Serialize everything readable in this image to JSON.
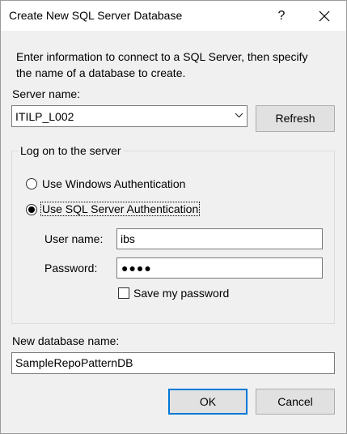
{
  "window": {
    "title": "Create New SQL Server Database",
    "help_label": "?"
  },
  "intro_text_line1": "Enter information to connect to a SQL Server, then specify",
  "intro_text_line2": "the name of a database to create.",
  "server": {
    "label": "Server name:",
    "value": "ITILP_L002",
    "refresh_label": "Refresh"
  },
  "logon": {
    "legend": "Log on to the server",
    "windows_auth_label": "Use Windows Authentication",
    "sql_auth_label": "Use SQL Server Authentication",
    "selected": "sql",
    "username_label": "User name:",
    "username_value": "ibs",
    "password_label": "Password:",
    "password_mask": "●●●●",
    "save_password_label": "Save my password",
    "save_password_checked": false
  },
  "database": {
    "label": "New database name:",
    "value": "SampleRepoPatternDB"
  },
  "buttons": {
    "ok_label": "OK",
    "cancel_label": "Cancel"
  },
  "colors": {
    "dialog_bg": "#f0f0f0",
    "default_button_border": "#0078d7"
  }
}
